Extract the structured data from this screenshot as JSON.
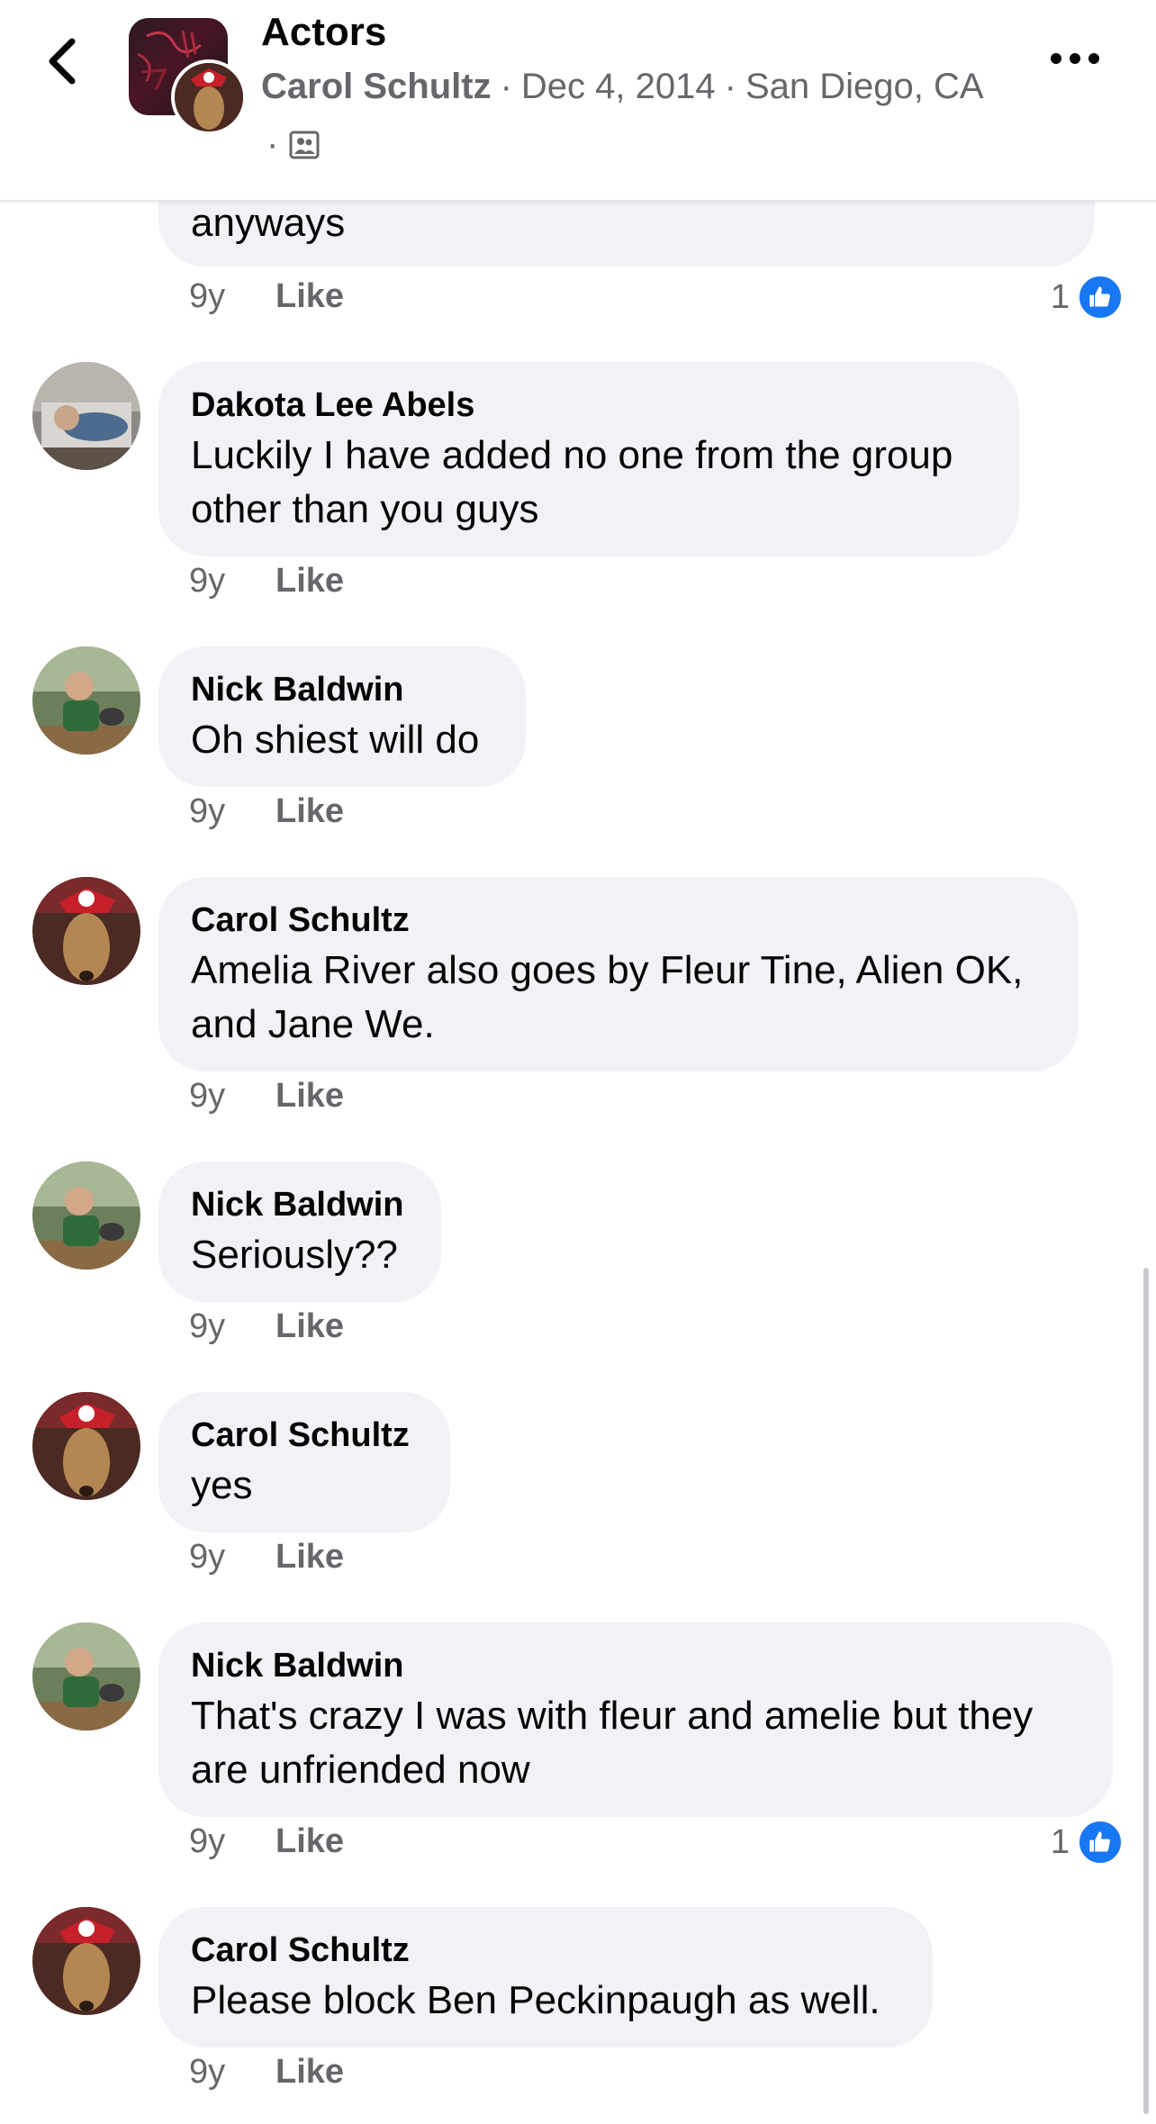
{
  "header": {
    "title": "Actors",
    "author": "Carol Schultz",
    "date": "Dec 4, 2014",
    "location": "San Diego, CA",
    "separator": "·",
    "audience_icon": "group-audience-icon"
  },
  "top_partial": {
    "text": "anyways",
    "time": "9y",
    "like_label": "Like",
    "reaction_count": "1"
  },
  "comments": [
    {
      "author": "Dakota Lee Abels",
      "text": "Luckily I have added no one from the group other than you guys",
      "time": "9y",
      "like_label": "Like"
    },
    {
      "author": "Nick Baldwin",
      "text": "Oh shiest will do",
      "time": "9y",
      "like_label": "Like"
    },
    {
      "author": "Carol Schultz",
      "text": "Amelia River also goes by Fleur Tine, Alien OK, and Jane We.",
      "time": "9y",
      "like_label": "Like"
    },
    {
      "author": "Nick Baldwin",
      "text": "Seriously??",
      "time": "9y",
      "like_label": "Like"
    },
    {
      "author": "Carol Schultz",
      "text": "yes",
      "time": "9y",
      "like_label": "Like"
    },
    {
      "author": "Nick Baldwin",
      "text": "That's crazy I was with fleur and amelie but they are unfriended now",
      "time": "9y",
      "like_label": "Like",
      "reaction_count": "1"
    },
    {
      "author": "Carol Schultz",
      "text": "Please block Ben Peckinpaugh as well.",
      "time": "9y",
      "like_label": "Like"
    }
  ],
  "colors": {
    "bubble": "#f0f2f5",
    "secondary_text": "#65676b",
    "like_blue": "#1877f2"
  }
}
